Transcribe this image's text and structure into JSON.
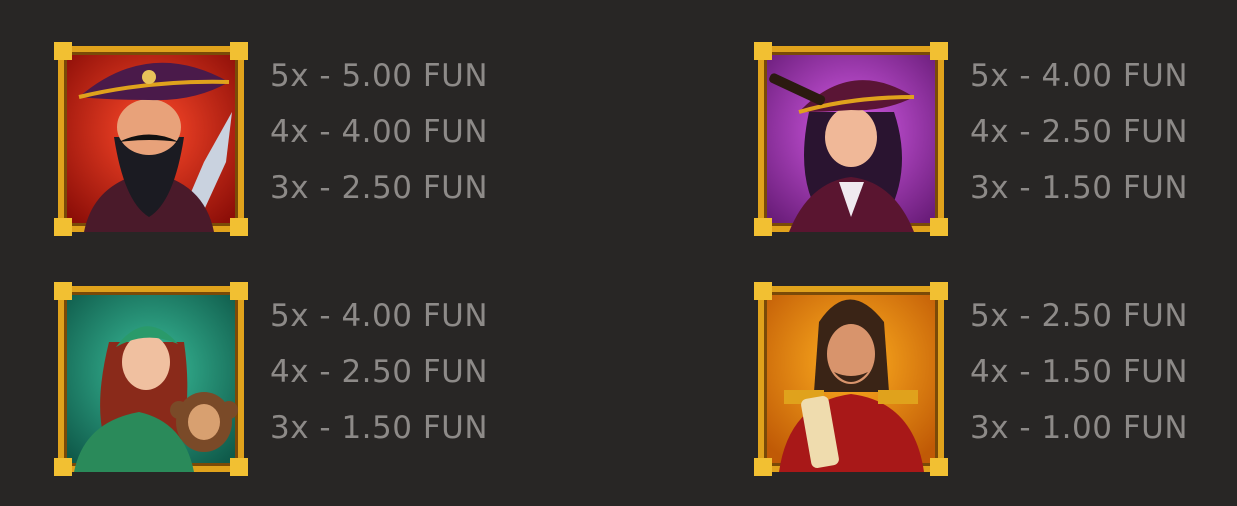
{
  "symbols": [
    {
      "character": "pirate-captain",
      "background": "#c21e12",
      "payouts": [
        "5x - 5.00 FUN",
        "4x - 4.00 FUN",
        "3x - 2.50 FUN"
      ]
    },
    {
      "character": "pirate-lady",
      "background": "#a02fb5",
      "payouts": [
        "5x - 4.00 FUN",
        "4x - 2.50 FUN",
        "3x - 1.50 FUN"
      ]
    },
    {
      "character": "gypsy-with-monkey",
      "background": "#1f8a72",
      "payouts": [
        "5x - 4.00 FUN",
        "4x - 2.50 FUN",
        "3x - 1.50 FUN"
      ]
    },
    {
      "character": "officer-with-scroll",
      "background": "#e37a0c",
      "payouts": [
        "5x - 2.50 FUN",
        "4x - 1.50 FUN",
        "3x - 1.00 FUN"
      ]
    }
  ],
  "colors": {
    "page_background": "#282625",
    "text": "#8d8a88",
    "frame_gold": "#e0a21c"
  }
}
